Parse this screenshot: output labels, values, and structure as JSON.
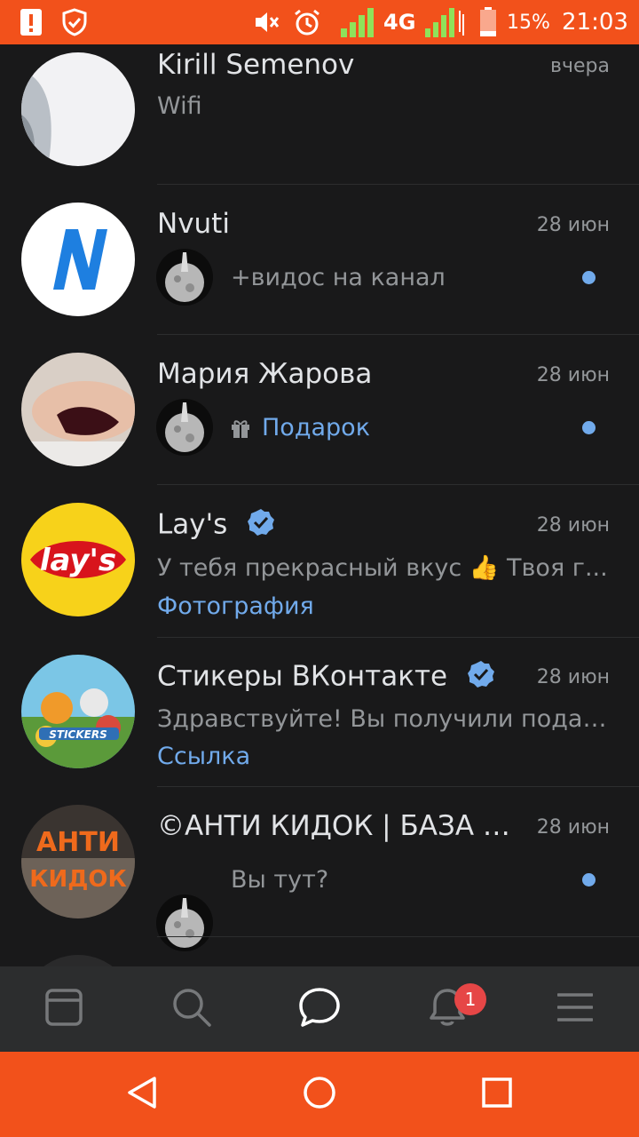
{
  "status_bar": {
    "network": "4G",
    "battery_percent": "15%",
    "time": "21:03",
    "icons": [
      "alert-icon",
      "shield-check-icon",
      "mute-icon",
      "alarm-icon",
      "signal-icon",
      "battery-icon"
    ]
  },
  "chats": [
    {
      "name": "Kirill Semenov",
      "date": "вчера",
      "message": "Wifi"
    },
    {
      "name": "Nvuti",
      "date": "28 июн",
      "message": "+видос на канал",
      "unread": true
    },
    {
      "name": "Мария Жарова",
      "date": "28 июн",
      "message": "Подарок",
      "unread": true,
      "gift": true
    },
    {
      "name": "Lay's",
      "date": "28 июн",
      "verified": true,
      "message": "У тебя прекрасный вкус 👍 Твоя г...",
      "attachment": "Фотография"
    },
    {
      "name": "Стикеры ВКонтакте",
      "date": "28 июн",
      "verified": true,
      "message": "Здравствуйте! Вы получили подар...",
      "attachment": "Ссылка"
    },
    {
      "name": "©АНТИ КИДОК | БАЗА К...",
      "date": "28 июн",
      "message": "Вы тут?",
      "unread": true
    }
  ],
  "bottom_nav": {
    "items": [
      "news-icon",
      "search-icon",
      "messages-icon",
      "notifications-icon",
      "menu-icon"
    ],
    "active": "messages-icon",
    "notifications_badge": "1"
  },
  "colors": {
    "accent": "#f2511b",
    "link": "#71aaeb",
    "background": "#19191a",
    "badge": "#e64646"
  }
}
